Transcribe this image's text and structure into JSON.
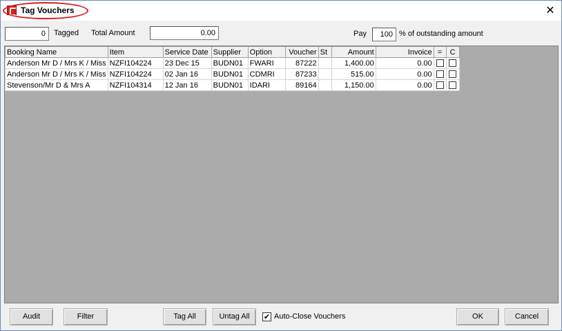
{
  "window": {
    "title": "Tag Vouchers",
    "close_glyph": "✕"
  },
  "top_bar": {
    "tagged_count": "0",
    "tagged_label": "Tagged",
    "total_amount_label": "Total Amount",
    "total_amount": "0.00",
    "pay_label": "Pay",
    "pay_percent": "100",
    "pay_suffix": "% of outstanding amount"
  },
  "grid": {
    "columns": {
      "booking_name": "Booking Name",
      "item": "Item",
      "service_date": "Service Date",
      "supplier": "Supplier",
      "option": "Option",
      "voucher": "Voucher",
      "st": "St",
      "amount": "Amount",
      "invoice": "Invoice",
      "eq": "=",
      "c": "C"
    },
    "rows": [
      {
        "booking_name": "Anderson Mr D  / Mrs K / Miss",
        "item": "NZFI104224",
        "service_date": "23 Dec 15",
        "supplier": "BUDN01",
        "option": "FWARI",
        "voucher": "87222",
        "st": "",
        "amount": "1,400.00",
        "invoice": "0.00"
      },
      {
        "booking_name": "Anderson Mr D  / Mrs K / Miss",
        "item": "NZFI104224",
        "service_date": "02 Jan 16",
        "supplier": "BUDN01",
        "option": "CDMRI",
        "voucher": "87233",
        "st": "",
        "amount": "515.00",
        "invoice": "0.00"
      },
      {
        "booking_name": "Stevenson/Mr D & Mrs A",
        "item": "NZFI104314",
        "service_date": "12 Jan 16",
        "supplier": "BUDN01",
        "option": "IDARI",
        "voucher": "89164",
        "st": "",
        "amount": "1,150.00",
        "invoice": "0.00"
      }
    ]
  },
  "buttons": {
    "audit": "Audit",
    "filter": "Filter",
    "tag_all": "Tag All",
    "untag_all": "Untag All",
    "ok": "OK",
    "cancel": "Cancel"
  },
  "auto_close": {
    "label": "Auto-Close Vouchers",
    "checked": true,
    "check_glyph": "✔"
  },
  "colors": {
    "annotation_circle": "#d81c1c",
    "grid_background": "#ababab",
    "window_bg": "#f0f0f0"
  }
}
